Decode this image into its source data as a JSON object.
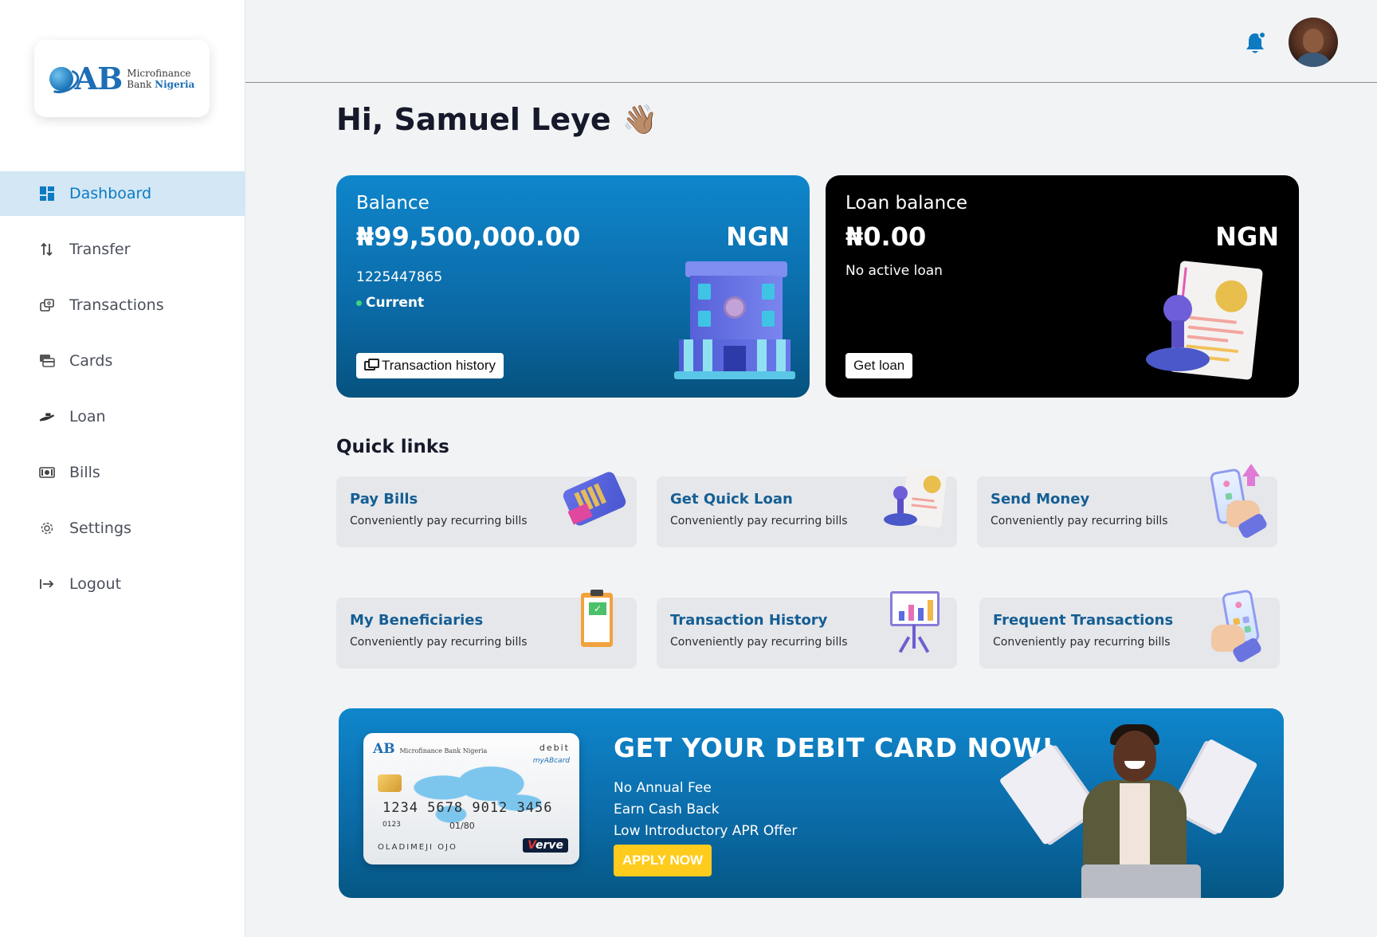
{
  "brand": {
    "logo_mark": "AB",
    "logo_line1": "Microfinance",
    "logo_line2a": "Bank",
    "logo_line2b": "Nigeria"
  },
  "sidebar": {
    "items": [
      {
        "label": "Dashboard",
        "icon": "grid-icon",
        "active": true
      },
      {
        "label": "Transfer",
        "icon": "swap-icon"
      },
      {
        "label": "Transactions",
        "icon": "transactions-icon"
      },
      {
        "label": "Cards",
        "icon": "cards-icon"
      },
      {
        "label": "Loan",
        "icon": "loan-icon"
      },
      {
        "label": "Bills",
        "icon": "bills-icon"
      },
      {
        "label": "Settings",
        "icon": "gear-icon"
      },
      {
        "label": "Logout",
        "icon": "logout-icon"
      }
    ]
  },
  "header": {
    "greeting": "Hi, Samuel Leye",
    "wave": "👋🏽",
    "bell_icon": "bell-icon",
    "bell_color": "#0d7ac1"
  },
  "balance_card": {
    "label": "Balance",
    "amount": "₦99,500,000.00",
    "currency": "NGN",
    "account_number": "1225447865",
    "account_type": "Current",
    "button_label": "Transaction history",
    "color": "#0f86cc"
  },
  "loan_card": {
    "label": "Loan balance",
    "amount": "₦0.00",
    "currency": "NGN",
    "status": "No active loan",
    "button_label": "Get loan",
    "color": "#000000"
  },
  "quick_links": {
    "title": "Quick links",
    "items": [
      {
        "name": "Pay Bills",
        "desc": "Conveniently pay recurring bills"
      },
      {
        "name": "Get Quick Loan",
        "desc": "Conveniently pay recurring bills"
      },
      {
        "name": "Send Money",
        "desc": "Conveniently pay recurring bills"
      },
      {
        "name": "My Beneficiaries",
        "desc": "Conveniently pay recurring bills"
      },
      {
        "name": "Transaction History",
        "desc": "Conveniently pay recurring bills"
      },
      {
        "name": "Frequent Transactions",
        "desc": "Conveniently pay recurring bills"
      }
    ]
  },
  "promo": {
    "title": "GET YOUR DEBIT CARD NOW!",
    "features": [
      "No Annual Fee",
      "Earn Cash Back",
      "Low Introductory APR Offer"
    ],
    "button_label": "APPLY NOW",
    "button_color": "#ffcc1d",
    "card": {
      "logo": "AB",
      "logo_sub": "Microfinance Bank Nigeria",
      "type": "debit",
      "product": "myABcard",
      "number": "1234 5678 9012 3456",
      "small": "0123",
      "expiry": "01/80",
      "holder": "OLADIMEJI OJO",
      "network": "Verve"
    }
  }
}
